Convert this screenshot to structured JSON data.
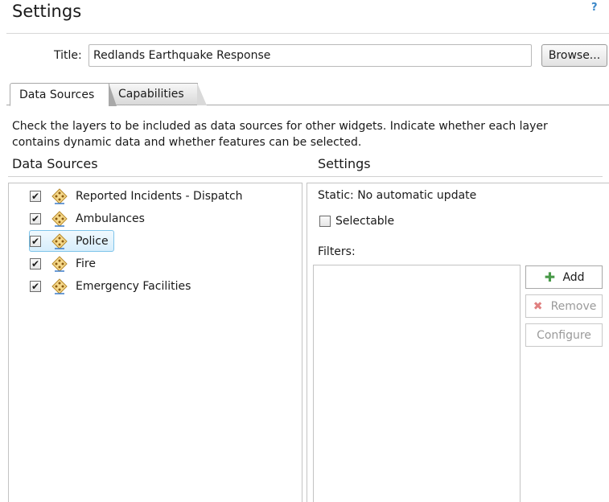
{
  "header": {
    "title": "Settings",
    "help": "?"
  },
  "title_field": {
    "label": "Title:",
    "value": "Redlands Earthquake Response"
  },
  "browse_label": "Browse...",
  "tabs": [
    {
      "label": "Data Sources",
      "active": true
    },
    {
      "label": "Capabilities",
      "active": false
    }
  ],
  "description": "Check the layers to be included as data sources for other widgets. Indicate whether each layer contains dynamic data and whether features can be selected.",
  "data_sources": {
    "heading": "Data Sources",
    "layers": [
      {
        "label": "Reported Incidents - Dispatch",
        "checked": true
      },
      {
        "label": "Ambulances",
        "checked": true
      },
      {
        "label": "Police",
        "checked": true,
        "selected": true
      },
      {
        "label": "Fire",
        "checked": true
      },
      {
        "label": "Emergency Facilities",
        "checked": true
      }
    ]
  },
  "settings": {
    "heading": "Settings",
    "static_text": "Static: No automatic update",
    "selectable_label": "Selectable",
    "filters_label": "Filters:",
    "add_label": "Add",
    "remove_label": "Remove",
    "configure_label": "Configure"
  },
  "colors": {
    "accent": "#3a87c8",
    "selection": "#d6edfb",
    "add_icon": "#4a9a4a",
    "remove_icon": "#e08080"
  }
}
